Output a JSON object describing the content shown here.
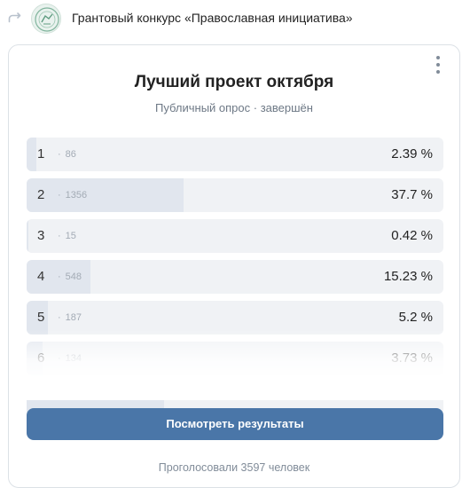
{
  "header": {
    "group_name": "Грантовый конкурс «Православная инициатива»"
  },
  "poll": {
    "title": "Лучший проект октября",
    "subtitle": "Публичный опрос · завершён",
    "options": [
      {
        "label": "1",
        "votes": "86",
        "percent_text": "2.39 %",
        "percent": 2.39
      },
      {
        "label": "2",
        "votes": "1356",
        "percent_text": "37.7 %",
        "percent": 37.7
      },
      {
        "label": "3",
        "votes": "15",
        "percent_text": "0.42 %",
        "percent": 0.42
      },
      {
        "label": "4",
        "votes": "548",
        "percent_text": "15.23 %",
        "percent": 15.23
      },
      {
        "label": "5",
        "votes": "187",
        "percent_text": "5.2 %",
        "percent": 5.2
      },
      {
        "label": "6",
        "votes": "134",
        "percent_text": "3.73 %",
        "percent": 3.73
      }
    ],
    "results_button": "Посмотреть результаты",
    "total_text": "Проголосовали 3597 человек"
  },
  "colors": {
    "accent": "#4a76a8",
    "bar_fill": "#e1e6ee",
    "bar_bg": "#f0f2f5"
  },
  "icons": {
    "repost": "repost-icon",
    "menu": "more-vertical-icon",
    "avatar": "group-logo"
  }
}
